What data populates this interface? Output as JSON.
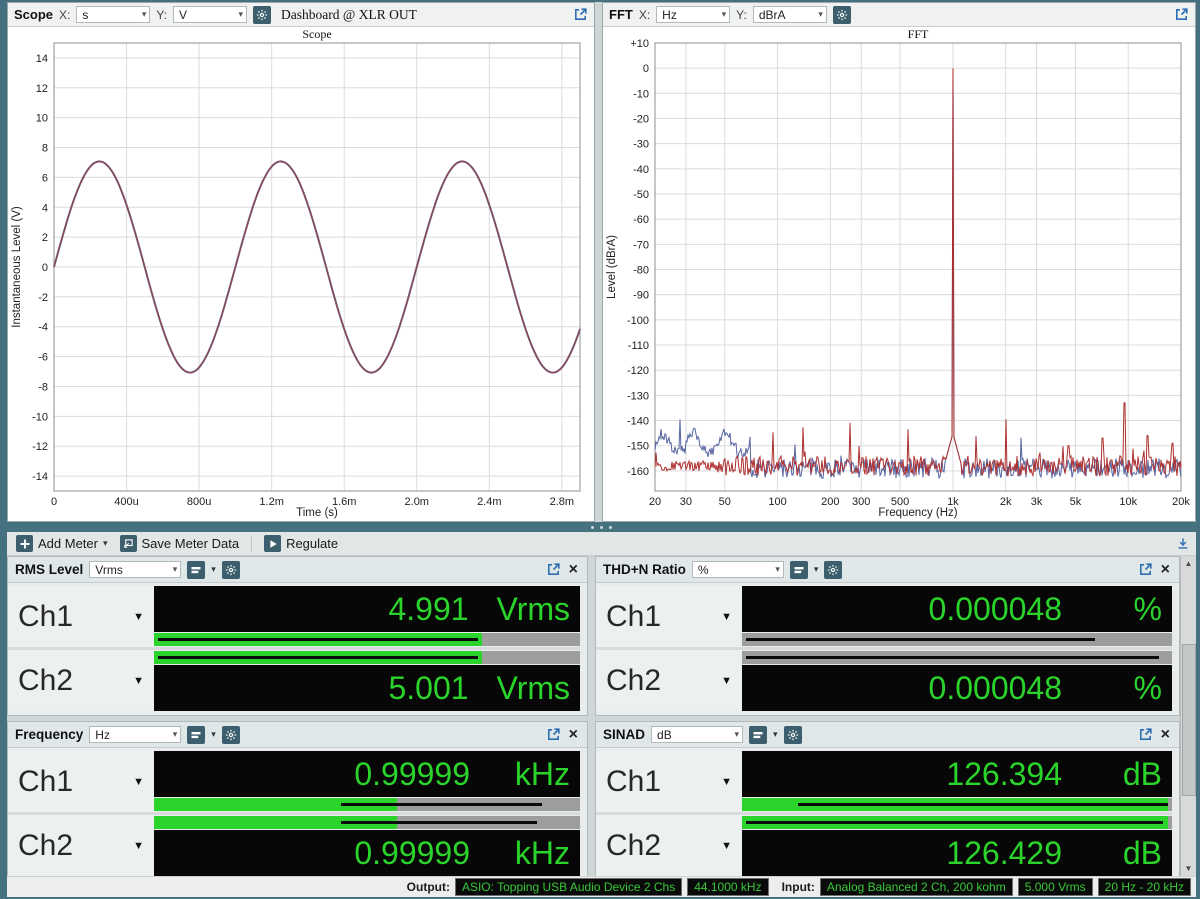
{
  "window": {
    "frame_color": "#44707f"
  },
  "scope_header": {
    "title": "Scope",
    "x_label": "X:",
    "x_value": "s",
    "y_label": "Y:",
    "y_value": "V",
    "dashboard": "Dashboard @ XLR OUT"
  },
  "fft_header": {
    "title": "FFT",
    "x_label": "X:",
    "x_value": "Hz",
    "y_label": "Y:",
    "y_value": "dBrA"
  },
  "toolbar": {
    "add_meter": "Add Meter",
    "save_meter_data": "Save Meter Data",
    "regulate": "Regulate"
  },
  "icons": {
    "panel_header": [
      "gear-icon",
      "popout-icon",
      "close-icon",
      "meter-display-icon"
    ],
    "toolbar": [
      "add-meter-plus-icon",
      "save-icon",
      "regulate-play-icon",
      "dock-icon"
    ],
    "scrollbar": [
      "scroll-up-icon",
      "scroll-down-icon"
    ]
  },
  "meters": [
    {
      "title": "RMS Level",
      "unit": "Vrms",
      "channels": [
        {
          "label": "Ch1",
          "value": "4.991",
          "unit": "Vrms",
          "bar": {
            "fill_pct": 77,
            "line_start_pct": 1,
            "line_end_pct": 76
          }
        },
        {
          "label": "Ch2",
          "value": "5.001",
          "unit": "Vrms",
          "bar": {
            "fill_pct": 77,
            "line_start_pct": 1,
            "line_end_pct": 76
          }
        }
      ]
    },
    {
      "title": "THD+N Ratio",
      "unit": "%",
      "channels": [
        {
          "label": "Ch1",
          "value": "0.000048",
          "unit": "%",
          "bar": {
            "fill_pct": 0,
            "line_start_pct": 1,
            "line_end_pct": 82
          }
        },
        {
          "label": "Ch2",
          "value": "0.000048",
          "unit": "%",
          "bar": {
            "fill_pct": 0,
            "line_start_pct": 1,
            "line_end_pct": 97
          }
        }
      ]
    },
    {
      "title": "Frequency",
      "unit": "Hz",
      "channels": [
        {
          "label": "Ch1",
          "value": "0.99999",
          "unit": "kHz",
          "bar": {
            "fill_pct": 57,
            "line_start_pct": 44,
            "line_end_pct": 91
          }
        },
        {
          "label": "Ch2",
          "value": "0.99999",
          "unit": "kHz",
          "bar": {
            "fill_pct": 57,
            "line_start_pct": 44,
            "line_end_pct": 90
          }
        }
      ]
    },
    {
      "title": "SINAD",
      "unit": "dB",
      "channels": [
        {
          "label": "Ch1",
          "value": "126.394",
          "unit": "dB",
          "bar": {
            "fill_pct": 99,
            "line_start_pct": 13,
            "line_end_pct": 99
          }
        },
        {
          "label": "Ch2",
          "value": "126.429",
          "unit": "dB",
          "bar": {
            "fill_pct": 99,
            "line_start_pct": 1,
            "line_end_pct": 98
          }
        }
      ]
    }
  ],
  "status_bar": {
    "output_label": "Output:",
    "output_badges": [
      "ASIO: Topping USB Audio Device 2 Chs",
      "44.1000 kHz"
    ],
    "input_label": "Input:",
    "input_badges": [
      "Analog Balanced 2 Ch, 200 kohm",
      "5.000 Vrms",
      "20 Hz - 20 kHz"
    ]
  },
  "chart_data": [
    {
      "type": "line",
      "title": "Scope",
      "xlabel": "Time (s)",
      "ylabel": "Instantaneous Level (V)",
      "xlim_s": [
        0,
        0.0029
      ],
      "ylim_v": [
        -15,
        15
      ],
      "y_tick_step": 2,
      "y_tick_min": -14,
      "y_tick_max": 14,
      "x_ticks": [
        {
          "v": 0,
          "label": "0"
        },
        {
          "v": 0.0004,
          "label": "400u"
        },
        {
          "v": 0.0008,
          "label": "800u"
        },
        {
          "v": 0.0012,
          "label": "1.2m"
        },
        {
          "v": 0.0016,
          "label": "1.6m"
        },
        {
          "v": 0.002,
          "label": "2.0m"
        },
        {
          "v": 0.0024,
          "label": "2.4m"
        },
        {
          "v": 0.0028,
          "label": "2.8m"
        }
      ],
      "series": [
        {
          "name": "Ch1",
          "color": "#5c6a9c"
        },
        {
          "name": "Ch2",
          "color": "#96444b"
        }
      ],
      "waveform": {
        "shape": "sine",
        "frequency_hz": 1000,
        "amplitude_v": 7.07,
        "phase_deg": 0,
        "cycles_visible": 2.9
      },
      "grid": true
    },
    {
      "type": "line",
      "title": "FFT",
      "xlabel": "Frequency (Hz)",
      "ylabel": "Level (dBrA)",
      "xscale": "log",
      "xlim_hz": [
        20,
        20000
      ],
      "ylim_db": [
        -168,
        10
      ],
      "y_tick_step": 10,
      "y_tick_min": -160,
      "y_tick_max": 10,
      "x_ticks": [
        {
          "v": 20,
          "label": "20"
        },
        {
          "v": 30,
          "label": "30"
        },
        {
          "v": 50,
          "label": "50"
        },
        {
          "v": 100,
          "label": "100"
        },
        {
          "v": 200,
          "label": "200"
        },
        {
          "v": 300,
          "label": "300"
        },
        {
          "v": 500,
          "label": "500"
        },
        {
          "v": 1000,
          "label": "1k"
        },
        {
          "v": 2000,
          "label": "2k"
        },
        {
          "v": 3000,
          "label": "3k"
        },
        {
          "v": 5000,
          "label": "5k"
        },
        {
          "v": 10000,
          "label": "10k"
        },
        {
          "v": 20000,
          "label": "20k"
        }
      ],
      "series": [
        {
          "name": "Ch1",
          "color": "#5563a0"
        },
        {
          "name": "Ch2",
          "color": "#ad2f2f"
        }
      ],
      "fundamental": {
        "freq_hz": 1000,
        "level_db": 0
      },
      "noise_floor_db": -158,
      "skirt_db": -145,
      "spurs": [
        {
          "f": 2300,
          "db": -150
        },
        {
          "f": 3600,
          "db": -147
        },
        {
          "f": 4800,
          "db": -133
        },
        {
          "f": 6500,
          "db": -146
        },
        {
          "f": 9000,
          "db": -149
        },
        {
          "f": 12000,
          "db": -141
        },
        {
          "f": 15000,
          "db": -148
        },
        {
          "f": 19000,
          "db": -143
        }
      ],
      "grid": true
    }
  ]
}
